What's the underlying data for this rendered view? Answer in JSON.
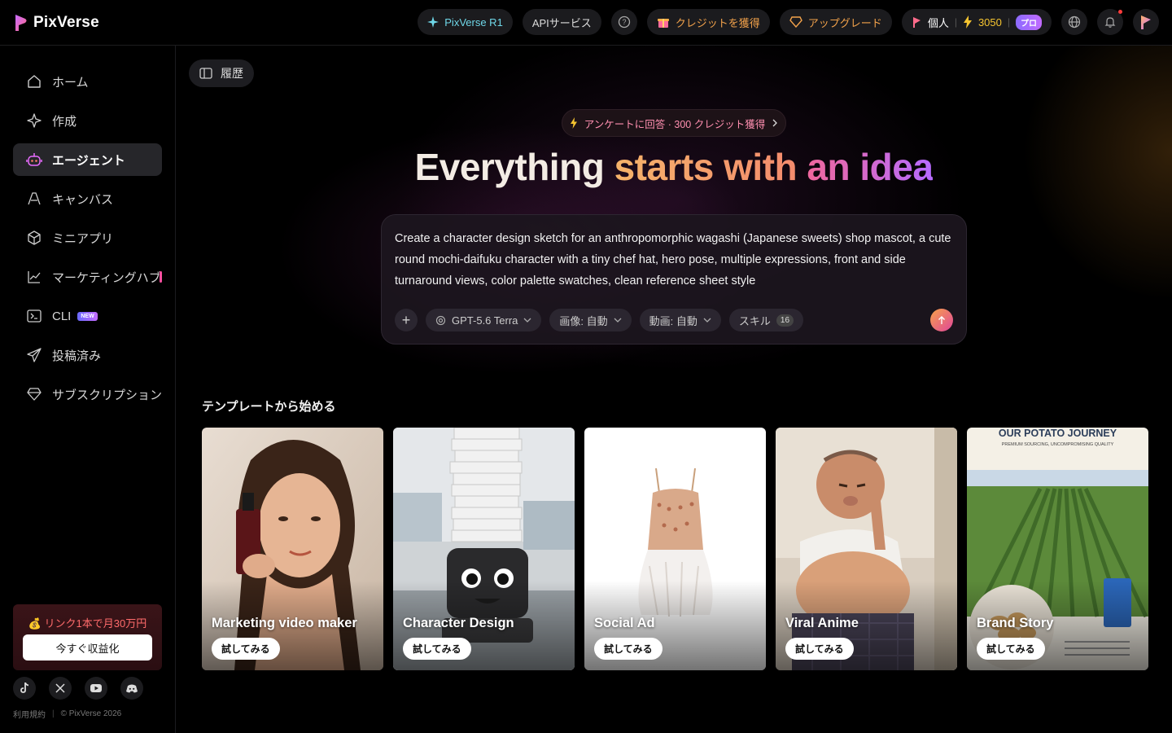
{
  "header": {
    "logo_text": "PixVerse",
    "r1_label": "PixVerse R1",
    "api_label": "APIサービス",
    "credits_label": "クレジットを獲得",
    "upgrade_label": "アップグレード",
    "account_label": "個人",
    "credit_count": "3050",
    "plan_badge": "プロ"
  },
  "sidebar": {
    "items": [
      {
        "label": "ホーム",
        "icon": "home-icon"
      },
      {
        "label": "作成",
        "icon": "sparkle-icon"
      },
      {
        "label": "エージェント",
        "icon": "robot-icon"
      },
      {
        "label": "キャンバス",
        "icon": "canvas-icon"
      },
      {
        "label": "ミニアプリ",
        "icon": "cube-icon"
      },
      {
        "label": "マーケティングハブ",
        "icon": "chart-icon"
      },
      {
        "label": "CLI",
        "icon": "terminal-icon",
        "badge": "NEW"
      },
      {
        "label": "投稿済み",
        "icon": "send-icon"
      },
      {
        "label": "サブスクリプション",
        "icon": "diamond-icon"
      }
    ],
    "promo": {
      "title": "💰 リンク1本で月30万円",
      "button": "今すぐ収益化"
    },
    "footer": {
      "terms": "利用規約",
      "copyright": "© PixVerse 2026"
    }
  },
  "main": {
    "history_label": "履歴",
    "survey_label": "アンケートに回答 · 300 クレジット獲得",
    "hero": {
      "part1": "Everything",
      "part2": "starts with",
      "part3": "an idea"
    },
    "prompt": {
      "text": "Create a character design sketch for an anthropomorphic wagashi (Japanese sweets) shop mascot, a cute round mochi-daifuku character with a tiny chef hat, hero pose, multiple expressions, front and side turnaround views, color palette swatches, clean reference sheet style",
      "model": "GPT-5.6 Terra",
      "image_mode": "画像: 自動",
      "video_mode": "動画: 自動",
      "skills_label": "スキル",
      "skills_count": "16"
    },
    "templates_title": "テンプレートから始める",
    "templates": [
      {
        "title": "Marketing video maker",
        "button": "試してみる"
      },
      {
        "title": "Character Design",
        "button": "試してみる"
      },
      {
        "title": "Social Ad",
        "button": "試してみる"
      },
      {
        "title": "Viral Anime",
        "button": "試してみる"
      },
      {
        "title": "Brand Story",
        "button": "試してみる",
        "poster_title": "OUR POTATO JOURNEY",
        "poster_subtitle": "PREMIUM SOURCING, UNCOMPROMISING QUALITY"
      }
    ]
  }
}
